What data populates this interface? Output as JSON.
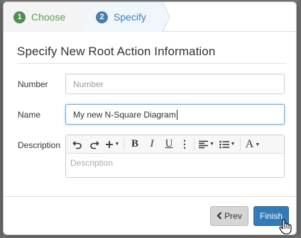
{
  "wizard": {
    "steps": [
      {
        "number": "1",
        "label": "Choose"
      },
      {
        "number": "2",
        "label": "Specify"
      }
    ]
  },
  "dialog": {
    "title": "Specify New Root Action Information"
  },
  "form": {
    "number_label": "Number",
    "number_placeholder": "Number",
    "name_label": "Name",
    "name_value": "My new N-Square Diagram",
    "description_label": "Description",
    "description_placeholder": "Description"
  },
  "editor_toolbar": {
    "bold": "B",
    "italic": "I",
    "underline": "U",
    "more": "⋮",
    "font": "A",
    "icons": [
      "undo-icon",
      "redo-icon",
      "insert-icon",
      "bold-icon",
      "italic-icon",
      "underline-icon",
      "more-icon",
      "align-icon",
      "list-icon",
      "font-color-icon"
    ]
  },
  "buttons": {
    "prev_label": "Prev",
    "finish_label": "Finish"
  },
  "colors": {
    "primary": "#337ab7",
    "step_done": "#4f8e4f",
    "step_active": "#4a7eab",
    "focus": "#66afe9"
  }
}
